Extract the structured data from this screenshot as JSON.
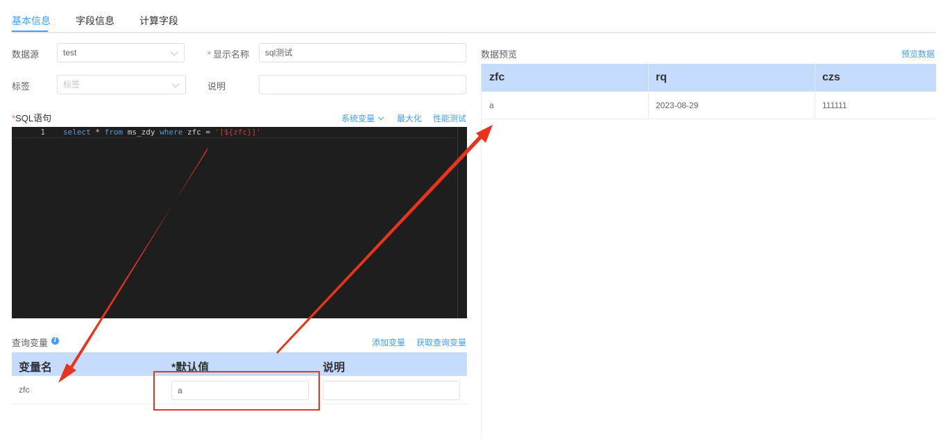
{
  "tabs": [
    "基本信息",
    "字段信息",
    "计算字段"
  ],
  "form": {
    "datasource_label": "数据源",
    "datasource_value": "test",
    "display_name_label": "显示名称",
    "display_name_value": "sql测试",
    "tag_label": "标签",
    "tag_placeholder": "标签",
    "desc_label": "说明",
    "desc_value": ""
  },
  "sql": {
    "label": "SQL语句",
    "actions": {
      "sys_var": "系统变量",
      "maximize": "最大化",
      "perf_test": "性能测试"
    },
    "line_number": "1",
    "code_kw1": "select",
    "code_p1": " * ",
    "code_kw2": "from",
    "code_p2": " ms_zdy ",
    "code_kw3": "where",
    "code_p3": " zfc = ",
    "code_str": "'[${zfc}]'"
  },
  "query_vars": {
    "title": "查询变量",
    "add_var": "添加变量",
    "fetch_vars": "获取查询变量",
    "columns": [
      "变量名",
      "*默认值",
      "说明"
    ],
    "rows": [
      {
        "name": "zfc",
        "default": "a",
        "desc": ""
      }
    ]
  },
  "preview": {
    "title": "数据预览",
    "preview_link": "预览数据",
    "columns": [
      "zfc",
      "rq",
      "czs"
    ],
    "rows": [
      [
        "a",
        "2023-08-29",
        "111111"
      ]
    ]
  },
  "colors": {
    "accent": "#409eff",
    "header_bg": "#c6dcff",
    "annotation": "#e8341d",
    "editor_bg": "#1e1e1e"
  }
}
